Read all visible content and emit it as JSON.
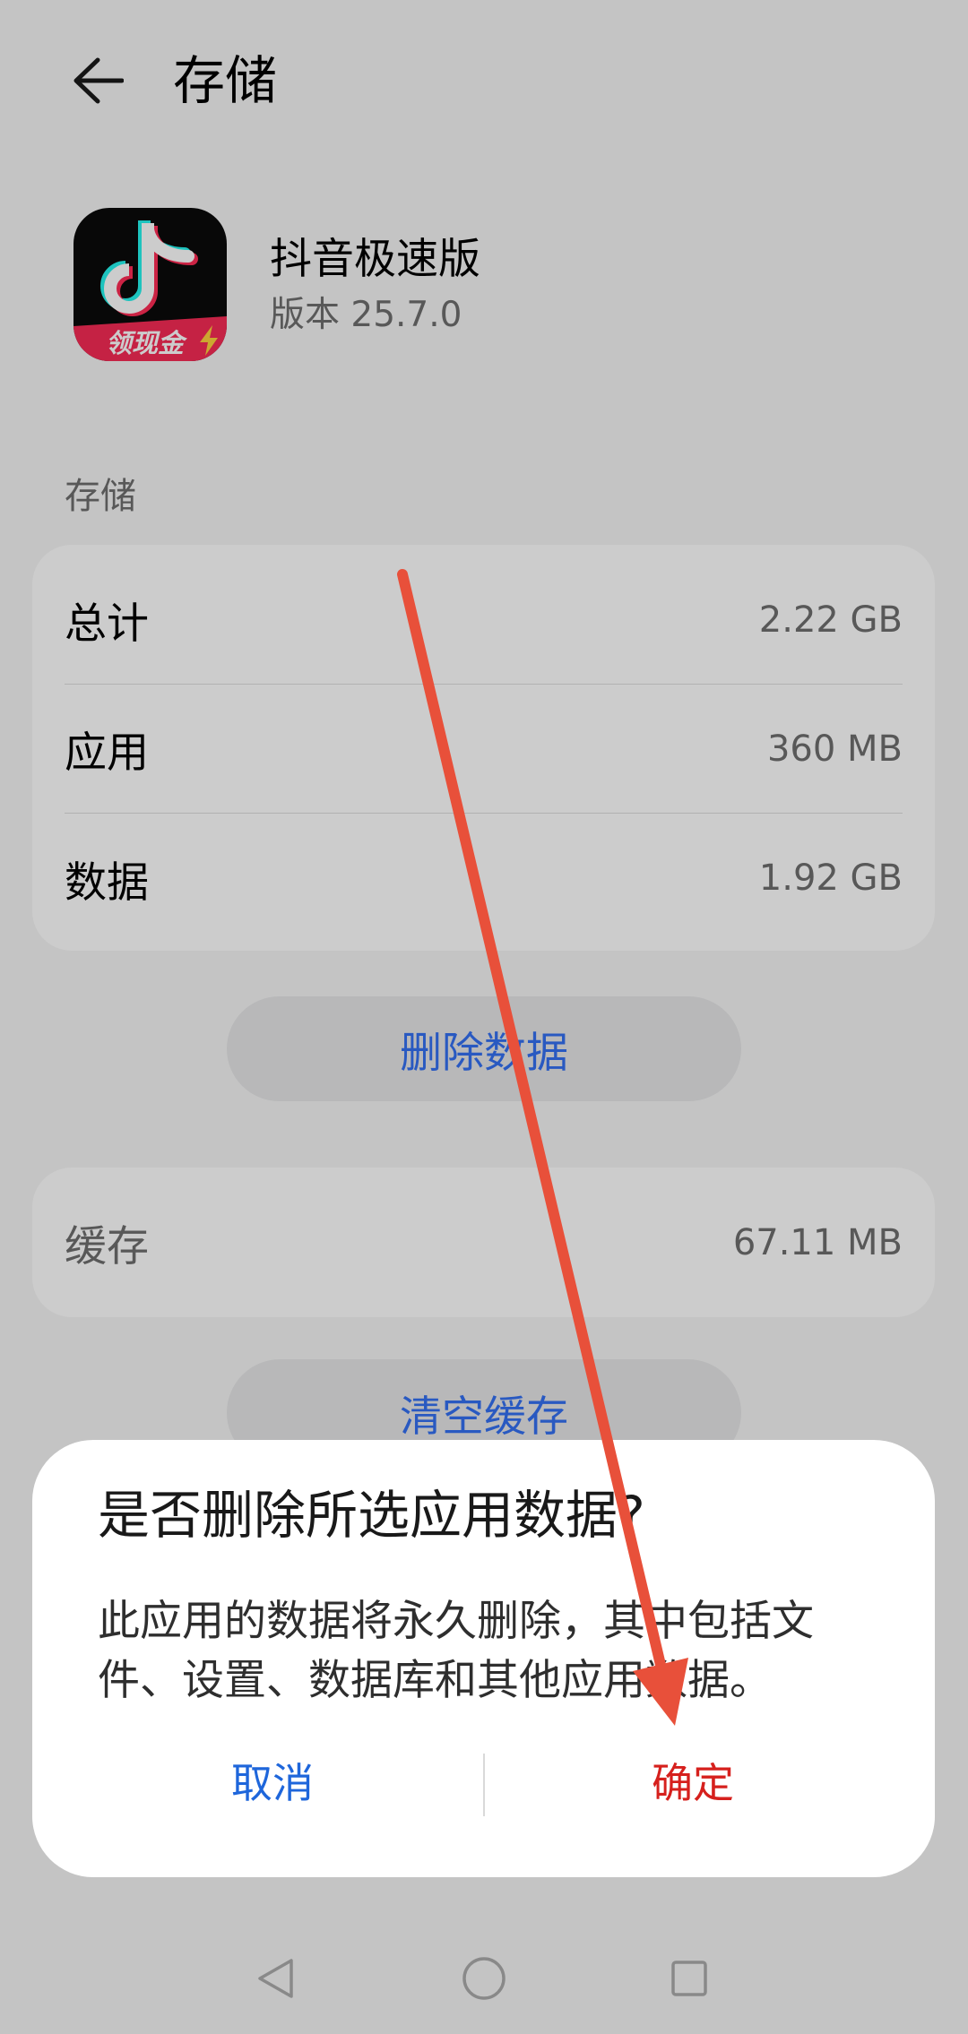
{
  "header": {
    "back_icon": "back-arrow-icon",
    "title": "存储"
  },
  "app": {
    "icon": "douyin-lite-app-icon",
    "icon_badge_text": "领现金",
    "name": "抖音极速版",
    "version": "版本 25.7.0"
  },
  "storage": {
    "section_label": "存储",
    "rows": [
      {
        "label": "总计",
        "value": "2.22 GB"
      },
      {
        "label": "应用",
        "value": "360 MB"
      },
      {
        "label": "数据",
        "value": "1.92 GB"
      }
    ],
    "delete_data_button": "删除数据"
  },
  "cache": {
    "label": "缓存",
    "value": "67.11 MB",
    "clear_cache_button": "清空缓存"
  },
  "dialog": {
    "title": "是否删除所选应用数据?",
    "message": "此应用的数据将永久删除，其中包括文件、设置、数据库和其他应用数据。",
    "cancel_button": "取消",
    "confirm_button": "确定"
  },
  "nav_bar": {
    "back_icon": "triangle-back-icon",
    "home_icon": "circle-home-icon",
    "recents_icon": "square-recents-icon"
  },
  "colors": {
    "page_bg": "#f5f5f5",
    "card_bg": "#ffffff",
    "pill_bg": "#e6e7e8",
    "text_primary": "#000000",
    "text_secondary": "#6e6e6e",
    "divider": "#dedede",
    "link_blue": "#3470f2",
    "scrim": "rgba(0, 0, 0, 0.2)",
    "dialog_bg": "#ffffff",
    "dialog_title": "#191919",
    "dialog_text": "#2e2e2e",
    "dialog_cancel": "#1e66db",
    "dialog_confirm": "#d6201d",
    "dialog_divider": "#d9d9d9",
    "nav_icon": "#acacac",
    "icon_ribbon": "#f72b55",
    "annotation_arrow": "#e8503a"
  }
}
